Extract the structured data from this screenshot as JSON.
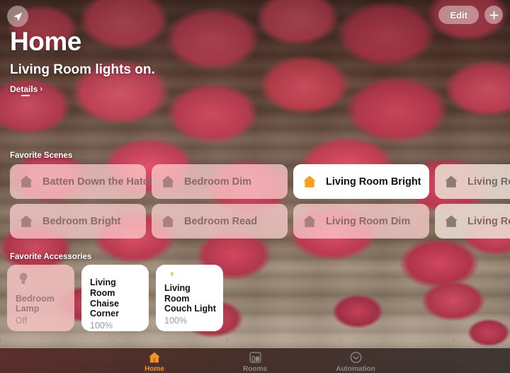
{
  "header": {
    "location_icon": "navigation-arrow-icon",
    "edit_label": "Edit",
    "add_icon": "plus-icon",
    "title": "Home",
    "status": "Living Room lights on.",
    "details_label": "Details",
    "details_chevron": "›"
  },
  "scenes": {
    "section_title": "Favorite Scenes",
    "row1": [
      {
        "label": "Batten Down the Hatches",
        "icon": "house-icon",
        "state": "inactive",
        "style": "pink"
      },
      {
        "label": "Bedroom Dim",
        "icon": "house-icon",
        "state": "inactive",
        "style": "pink"
      },
      {
        "label": "Living Room Bright",
        "icon": "house-icon",
        "state": "active",
        "style": "white"
      },
      {
        "label": "Living Room",
        "icon": "house-icon",
        "state": "inactive",
        "style": "beige"
      }
    ],
    "row2": [
      {
        "label": "Bedroom Bright",
        "icon": "house-icon",
        "state": "inactive",
        "style": "pink"
      },
      {
        "label": "Bedroom Read",
        "icon": "house-icon",
        "state": "inactive",
        "style": "pink"
      },
      {
        "label": "Living Room Dim",
        "icon": "house-icon",
        "state": "inactive",
        "style": "pink"
      },
      {
        "label": "Living Room",
        "icon": "house-icon",
        "state": "inactive",
        "style": "beige"
      }
    ]
  },
  "accessories": {
    "section_title": "Favorite Accessories",
    "items": [
      {
        "name": "Bedroom Lamp",
        "state": "Off",
        "icon": "lightbulb-icon",
        "on": false
      },
      {
        "name": "Living Room Chaise Corner",
        "state": "100%",
        "icon": "lightbulb-icon",
        "on": true
      },
      {
        "name": "Living Room Couch Light",
        "state": "100%",
        "icon": "lightbulb-icon",
        "on": true
      }
    ]
  },
  "tabbar": {
    "tabs": [
      {
        "label": "Home",
        "icon": "house-icon",
        "active": true
      },
      {
        "label": "Rooms",
        "icon": "rooms-icon",
        "active": false
      },
      {
        "label": "Automation",
        "icon": "automation-clock-icon",
        "active": false
      }
    ]
  },
  "colors": {
    "accent_orange": "#f0922b",
    "scene_pink": "rgba(255,210,210,0.72)",
    "scene_beige": "rgba(236,222,212,0.86)",
    "bulb_yellow": "#f5c518",
    "bulb_off": "#b08c8c"
  }
}
